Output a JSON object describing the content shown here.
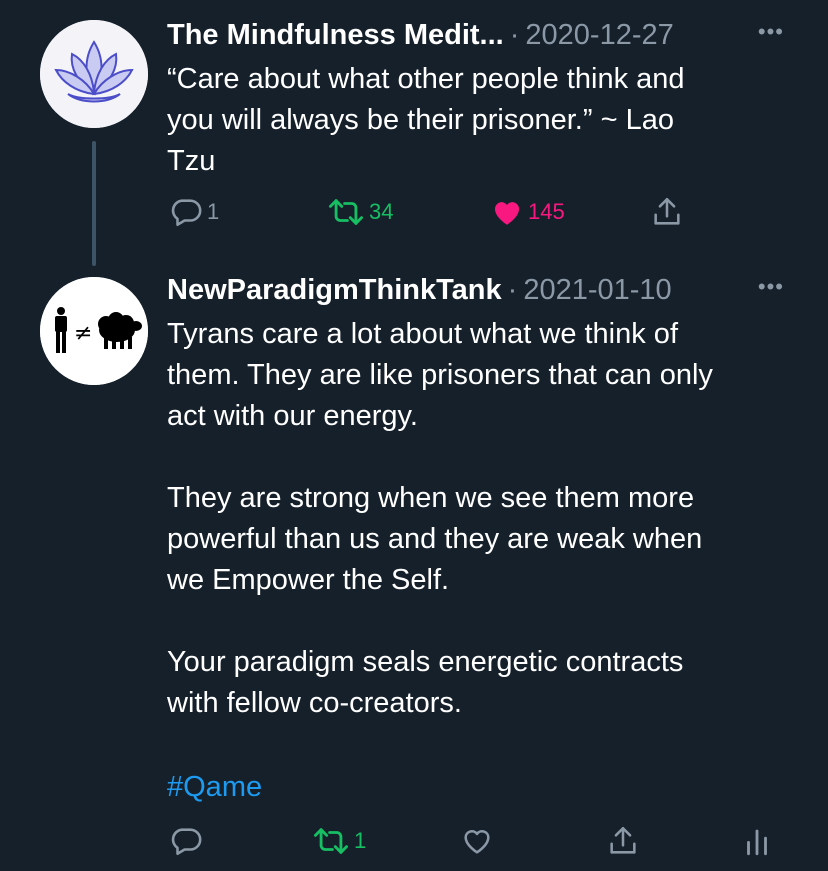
{
  "tweets": [
    {
      "author": "The Mindfulness Medit...",
      "separator": "·",
      "date": "2020-12-27",
      "more": "•••",
      "text": "“Care about what other people think and\nyou will always be their prisoner.” ~ Lao\nTzu",
      "reply_count": "1",
      "retweet_count": "34",
      "like_count": "145",
      "avatar_icon": "lotus-icon",
      "liked": true
    },
    {
      "author": "NewParadigmThinkTank",
      "separator": "·",
      "date": "2021-01-10",
      "more": "•••",
      "text": "Tyrans care a lot about what we think of\nthem. They are like prisoners that can only\nact with our energy.\n\nThey are strong when we see them more\npowerful than us and they are weak when\nwe Empower the Self.\n\nYour paradigm seals energetic contracts\nwith fellow co-creators.",
      "hashtag": "#Qame",
      "retweet_count": "1",
      "avatar_icon": "person-not-equal-sheep-icon",
      "avatar_symbol": "≠"
    }
  ],
  "colors": {
    "background": "#15202b",
    "muted": "#8b98a5",
    "retweet_green": "#17bf63",
    "like_pink": "#f91880",
    "link_blue": "#1d9bf0"
  }
}
